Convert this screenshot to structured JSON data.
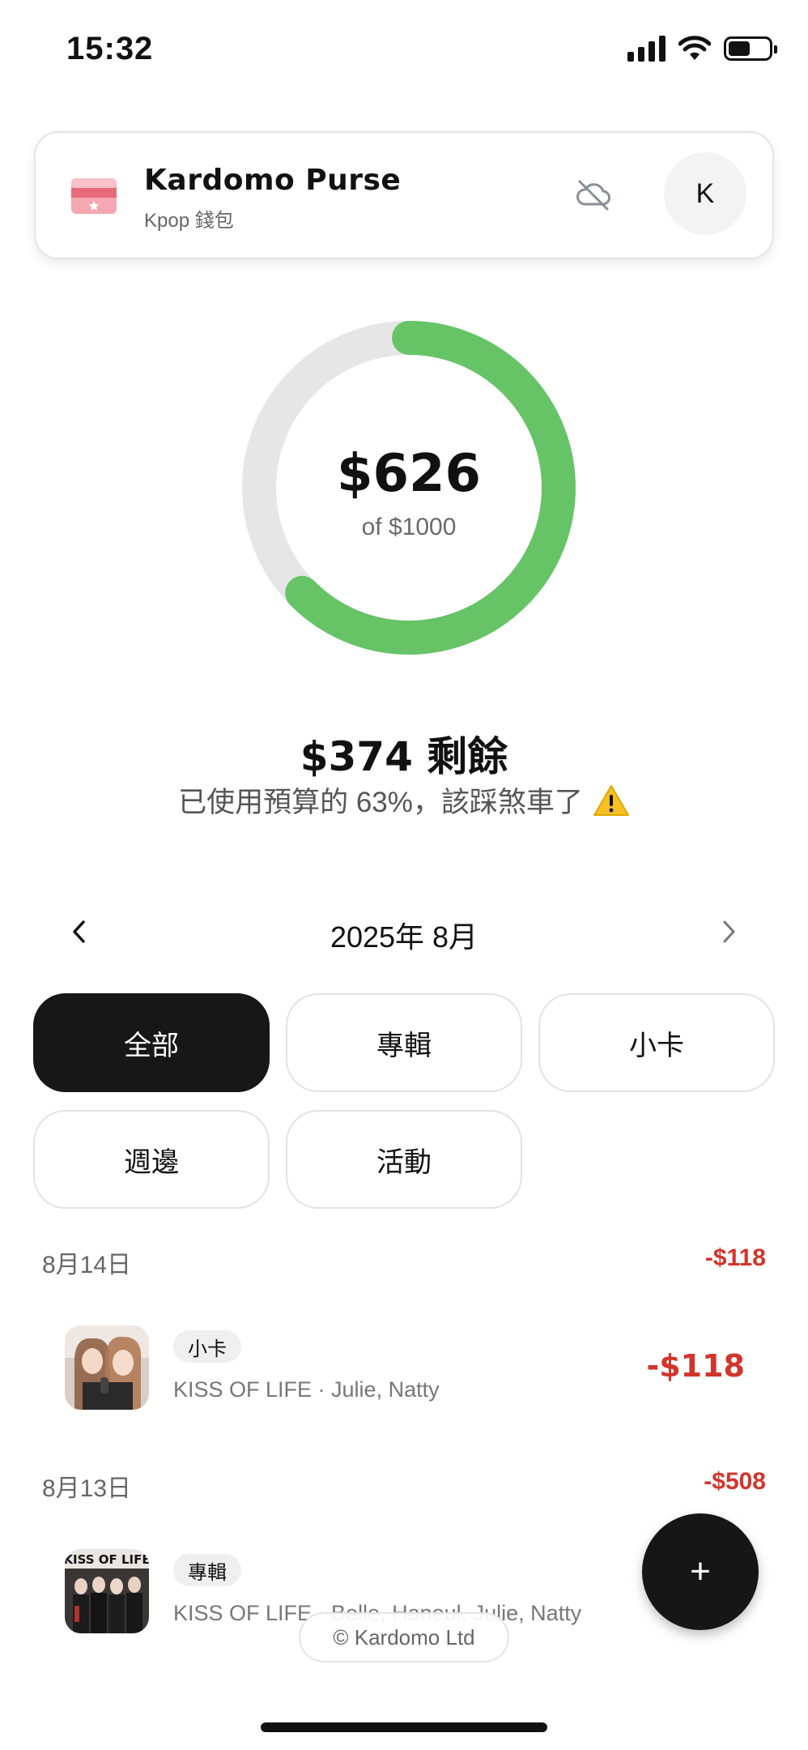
{
  "status_bar": {
    "time": "15:32"
  },
  "header": {
    "title": "Kardomo Purse",
    "subtitle": "Kpop 錢包",
    "avatar_initial": "K"
  },
  "budget": {
    "spent": "$626",
    "of_total": "of $1000",
    "spent_fraction": 0.626,
    "remaining": "$374 剩餘",
    "usage_text": "已使用預算的 63%，該踩煞車了",
    "ring_color": "#66c466",
    "track_color": "#e6e6e6"
  },
  "month_nav": {
    "label": "2025年 8月"
  },
  "filters": [
    "全部",
    "專輯",
    "小卡",
    "週邊",
    "活動"
  ],
  "groups": [
    {
      "date": "8月14日",
      "total": "-$118",
      "items": [
        {
          "tag": "小卡",
          "desc": "KISS OF LIFE · Julie, Natty",
          "amount": "-$118"
        }
      ]
    },
    {
      "date": "8月13日",
      "total": "-$508",
      "items": [
        {
          "tag": "專輯",
          "desc": "KISS OF LIFE · Belle, Haneul, Julie, Natty",
          "amount": "-$",
          "thumb_text": "KISS OF LIFE"
        }
      ]
    }
  ],
  "fab": {
    "label": "+"
  },
  "footer": {
    "text": "© Kardomo Ltd"
  },
  "colors": {
    "negative": "#d2352c",
    "dark": "#171717"
  }
}
